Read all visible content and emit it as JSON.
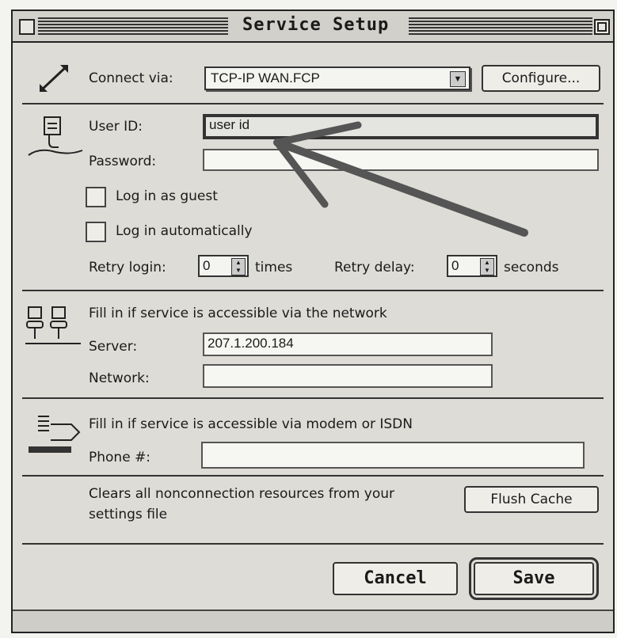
{
  "window": {
    "title": "Service Setup"
  },
  "connection": {
    "connect_via_label": "Connect via:",
    "connect_via_value": "TCP-IP WAN.FCP",
    "configure_label": "Configure..."
  },
  "login": {
    "user_id_label": "User ID:",
    "user_id_value": "user id",
    "password_label": "Password:",
    "password_value": "",
    "guest_label": "Log in as guest",
    "auto_label": "Log in automatically",
    "retry_login_label": "Retry login:",
    "retry_login_value": "0",
    "times_label": "times",
    "retry_delay_label": "Retry delay:",
    "retry_delay_value": "0",
    "seconds_label": "seconds"
  },
  "network": {
    "heading": "Fill in if service is accessible via the network",
    "server_label": "Server:",
    "server_value": "207.1.200.184",
    "network_label": "Network:",
    "network_value": ""
  },
  "modem": {
    "heading": "Fill in if service is accessible via modem or ISDN",
    "phone_label": "Phone #:",
    "phone_value": ""
  },
  "cache": {
    "description_line1": "Clears all nonconnection resources from your",
    "description_line2": "settings file",
    "flush_label": "Flush Cache"
  },
  "actions": {
    "cancel_label": "Cancel",
    "save_label": "Save"
  },
  "icons": {
    "connect": "connection-arrows-icon",
    "user": "user-hand-icon",
    "network": "network-computers-icon",
    "modem": "modem-icon",
    "annotation": "annotation-arrow-icon"
  }
}
